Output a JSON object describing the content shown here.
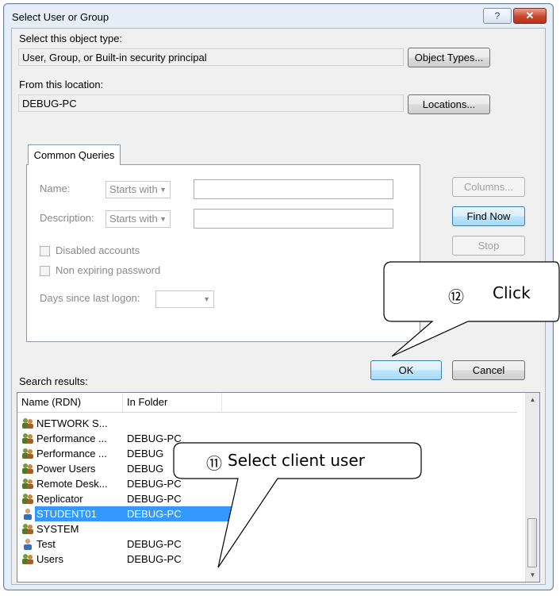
{
  "window": {
    "title": "Select User or Group",
    "help_glyph": "?",
    "close_glyph": "✕"
  },
  "object_type": {
    "label": "Select this object type:",
    "value": "User, Group, or Built-in security principal",
    "button": "Object Types..."
  },
  "location": {
    "label": "From this location:",
    "value": "DEBUG-PC",
    "button": "Locations..."
  },
  "common_queries": {
    "tab_label": "Common Queries",
    "name_label": "Name:",
    "name_mode": "Starts with",
    "name_value": "",
    "description_label": "Description:",
    "description_mode": "Starts with",
    "description_value": "",
    "disabled_accounts": "Disabled accounts",
    "non_expiring_password": "Non expiring password",
    "days_since_logon_label": "Days since last logon:",
    "days_value": ""
  },
  "side_buttons": {
    "columns": "Columns...",
    "find_now": "Find Now",
    "stop": "Stop"
  },
  "dialog_buttons": {
    "ok": "OK",
    "cancel": "Cancel"
  },
  "results": {
    "label": "Search results:",
    "headers": [
      "Name (RDN)",
      "In Folder"
    ],
    "rows": [
      {
        "name": "NETWORK S...",
        "folder": "",
        "icon": "group-icon"
      },
      {
        "name": "Performance ...",
        "folder": "DEBUG-PC",
        "icon": "group-icon"
      },
      {
        "name": "Performance ...",
        "folder": "DEBUG",
        "icon": "group-icon"
      },
      {
        "name": "Power Users",
        "folder": "DEBUG",
        "icon": "group-icon"
      },
      {
        "name": "Remote Desk...",
        "folder": "DEBUG-PC",
        "icon": "group-icon"
      },
      {
        "name": "Replicator",
        "folder": "DEBUG-PC",
        "icon": "group-icon"
      },
      {
        "name": "STUDENT01",
        "folder": "DEBUG-PC",
        "icon": "user-icon",
        "selected": true
      },
      {
        "name": "SYSTEM",
        "folder": "",
        "icon": "group-icon"
      },
      {
        "name": "Test",
        "folder": "DEBUG-PC",
        "icon": "user-icon"
      },
      {
        "name": "Users",
        "folder": "DEBUG-PC",
        "icon": "group-icon"
      }
    ]
  },
  "annotations": {
    "click": {
      "number": "⑫",
      "text": "Click"
    },
    "select": {
      "number": "⑪",
      "text": "Select client user"
    }
  },
  "colors": {
    "selection": "#3399ff",
    "window_frame": "#e5edf7",
    "close_button": "#c9462e"
  }
}
